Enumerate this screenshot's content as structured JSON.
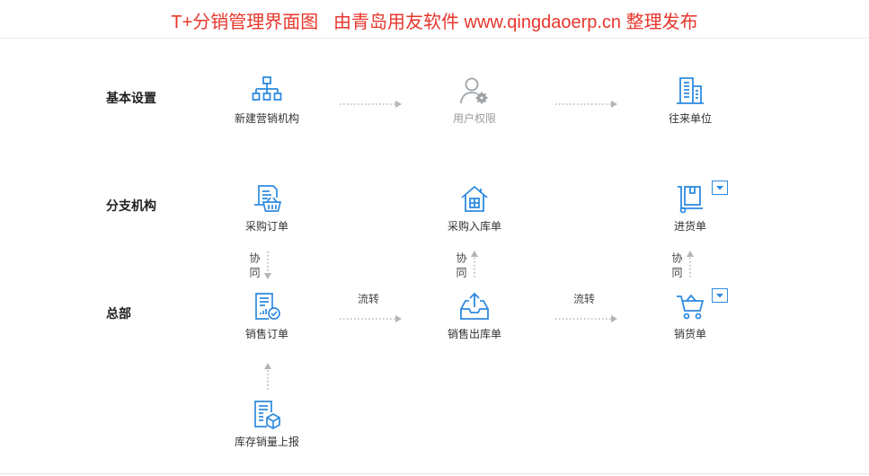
{
  "banner": {
    "title": "T+分销管理界面图   由青岛用友软件 www.qingdaoerp.cn 整理发布"
  },
  "colors": {
    "banner_text": "#e8362c",
    "icon_accent": "#2f8ae0",
    "icon_disabled": "#9ea3a8",
    "connector": "#b4b4b4",
    "label_text": "#333333"
  },
  "lanes": [
    {
      "label": "基本设置"
    },
    {
      "label": "分支机构"
    },
    {
      "label": "总部"
    }
  ],
  "nodes": {
    "new_sales_org": {
      "label": "新建营销机构",
      "icon": "org-chart-icon"
    },
    "user_permissions": {
      "label": "用户权限",
      "icon": "user-gear-icon",
      "state": "disabled"
    },
    "partners": {
      "label": "往来单位",
      "icon": "building-icon"
    },
    "purchase_order": {
      "label": "采购订单",
      "icon": "purchase-basket-icon"
    },
    "purchase_receipt": {
      "label": "采购入库单",
      "icon": "warehouse-icon"
    },
    "purchase_invoice": {
      "label": "进货单",
      "icon": "hand-truck-icon",
      "has_dropdown": true
    },
    "sales_order": {
      "label": "销售订单",
      "icon": "order-check-icon"
    },
    "sales_delivery": {
      "label": "销售出库单",
      "icon": "tray-out-icon"
    },
    "sales_invoice": {
      "label": "销货单",
      "icon": "cart-icon",
      "has_dropdown": true
    },
    "inventory_report": {
      "label": "库存销量上报",
      "icon": "inventory-report-icon"
    }
  },
  "connectors": {
    "sync_labels": [
      "协同",
      "协同",
      "协同"
    ],
    "flow_labels": [
      "流转",
      "流转"
    ]
  },
  "dropdown_icon": "caret-down-icon"
}
